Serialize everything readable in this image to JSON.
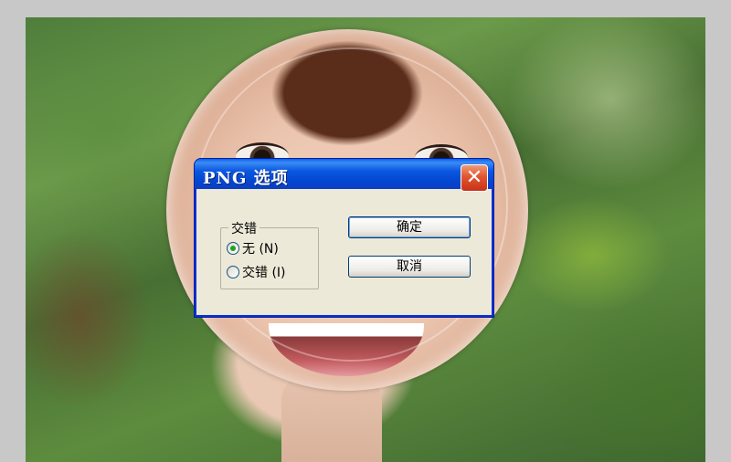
{
  "dialog": {
    "title": "PNG 选项",
    "close_glyph": "✕",
    "group_label": "交错",
    "options": [
      {
        "label": "无 (N)",
        "checked": true
      },
      {
        "label": "交错 (I)",
        "checked": false
      }
    ],
    "ok_label": "确定",
    "cancel_label": "取消"
  },
  "colors": {
    "titlebar": "#0b58e0",
    "dialog_bg": "#ece9d8",
    "close_button": "#e2552f"
  }
}
